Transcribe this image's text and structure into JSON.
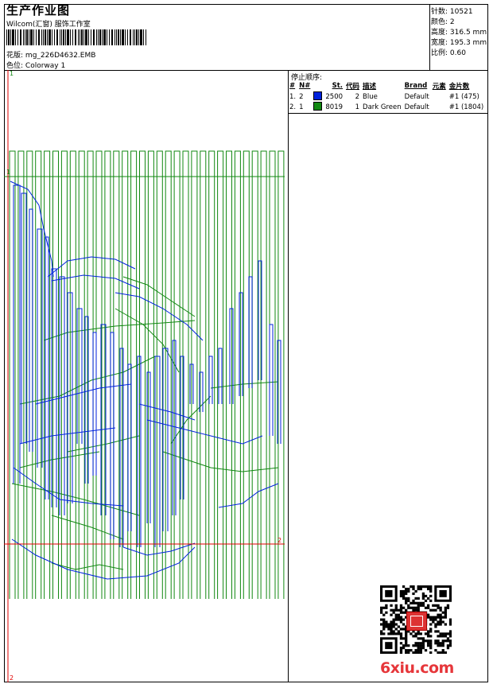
{
  "header": {
    "title": "生产作业图",
    "subtitle": "Wilcom(汇窗) 服饰工作室",
    "design_label": "花版:",
    "design_file": "mg_226D4632.EMB",
    "colorway_label": "色位:",
    "colorway": "Colorway 1"
  },
  "specs": [
    {
      "label": "针数:",
      "value": "10521"
    },
    {
      "label": "颜色:",
      "value": "2"
    },
    {
      "label": "高度:",
      "value": "316.5 mm"
    },
    {
      "label": "宽度:",
      "value": "195.3 mm"
    },
    {
      "label": "比例:",
      "value": "0.60"
    }
  ],
  "stop_sequence": {
    "title": "停止顺序:",
    "headers": [
      "#",
      "N#",
      "St.",
      "代码",
      "描述",
      "Brand",
      "元素",
      "金片数"
    ],
    "rows": [
      {
        "num": "1.",
        "needle": "2",
        "color": "#0022dd",
        "code": "2500",
        "stitches": "2",
        "desc": "Blue",
        "brand": "Default",
        "elements": "#1 (475)"
      },
      {
        "num": "2.",
        "needle": "1",
        "color": "#118811",
        "code": "8019",
        "stitches": "1",
        "desc": "Dark Green",
        "brand": "Default",
        "elements": "#1 (1804)"
      }
    ]
  },
  "markers": {
    "top_left": "1",
    "left_mid": "1",
    "right_bottom": "2",
    "bottom_left": "2"
  },
  "watermark": "6xiu.com",
  "colors": {
    "blue_thread": "#0022dd",
    "green_thread": "#118811",
    "red_guide": "#e00000"
  }
}
